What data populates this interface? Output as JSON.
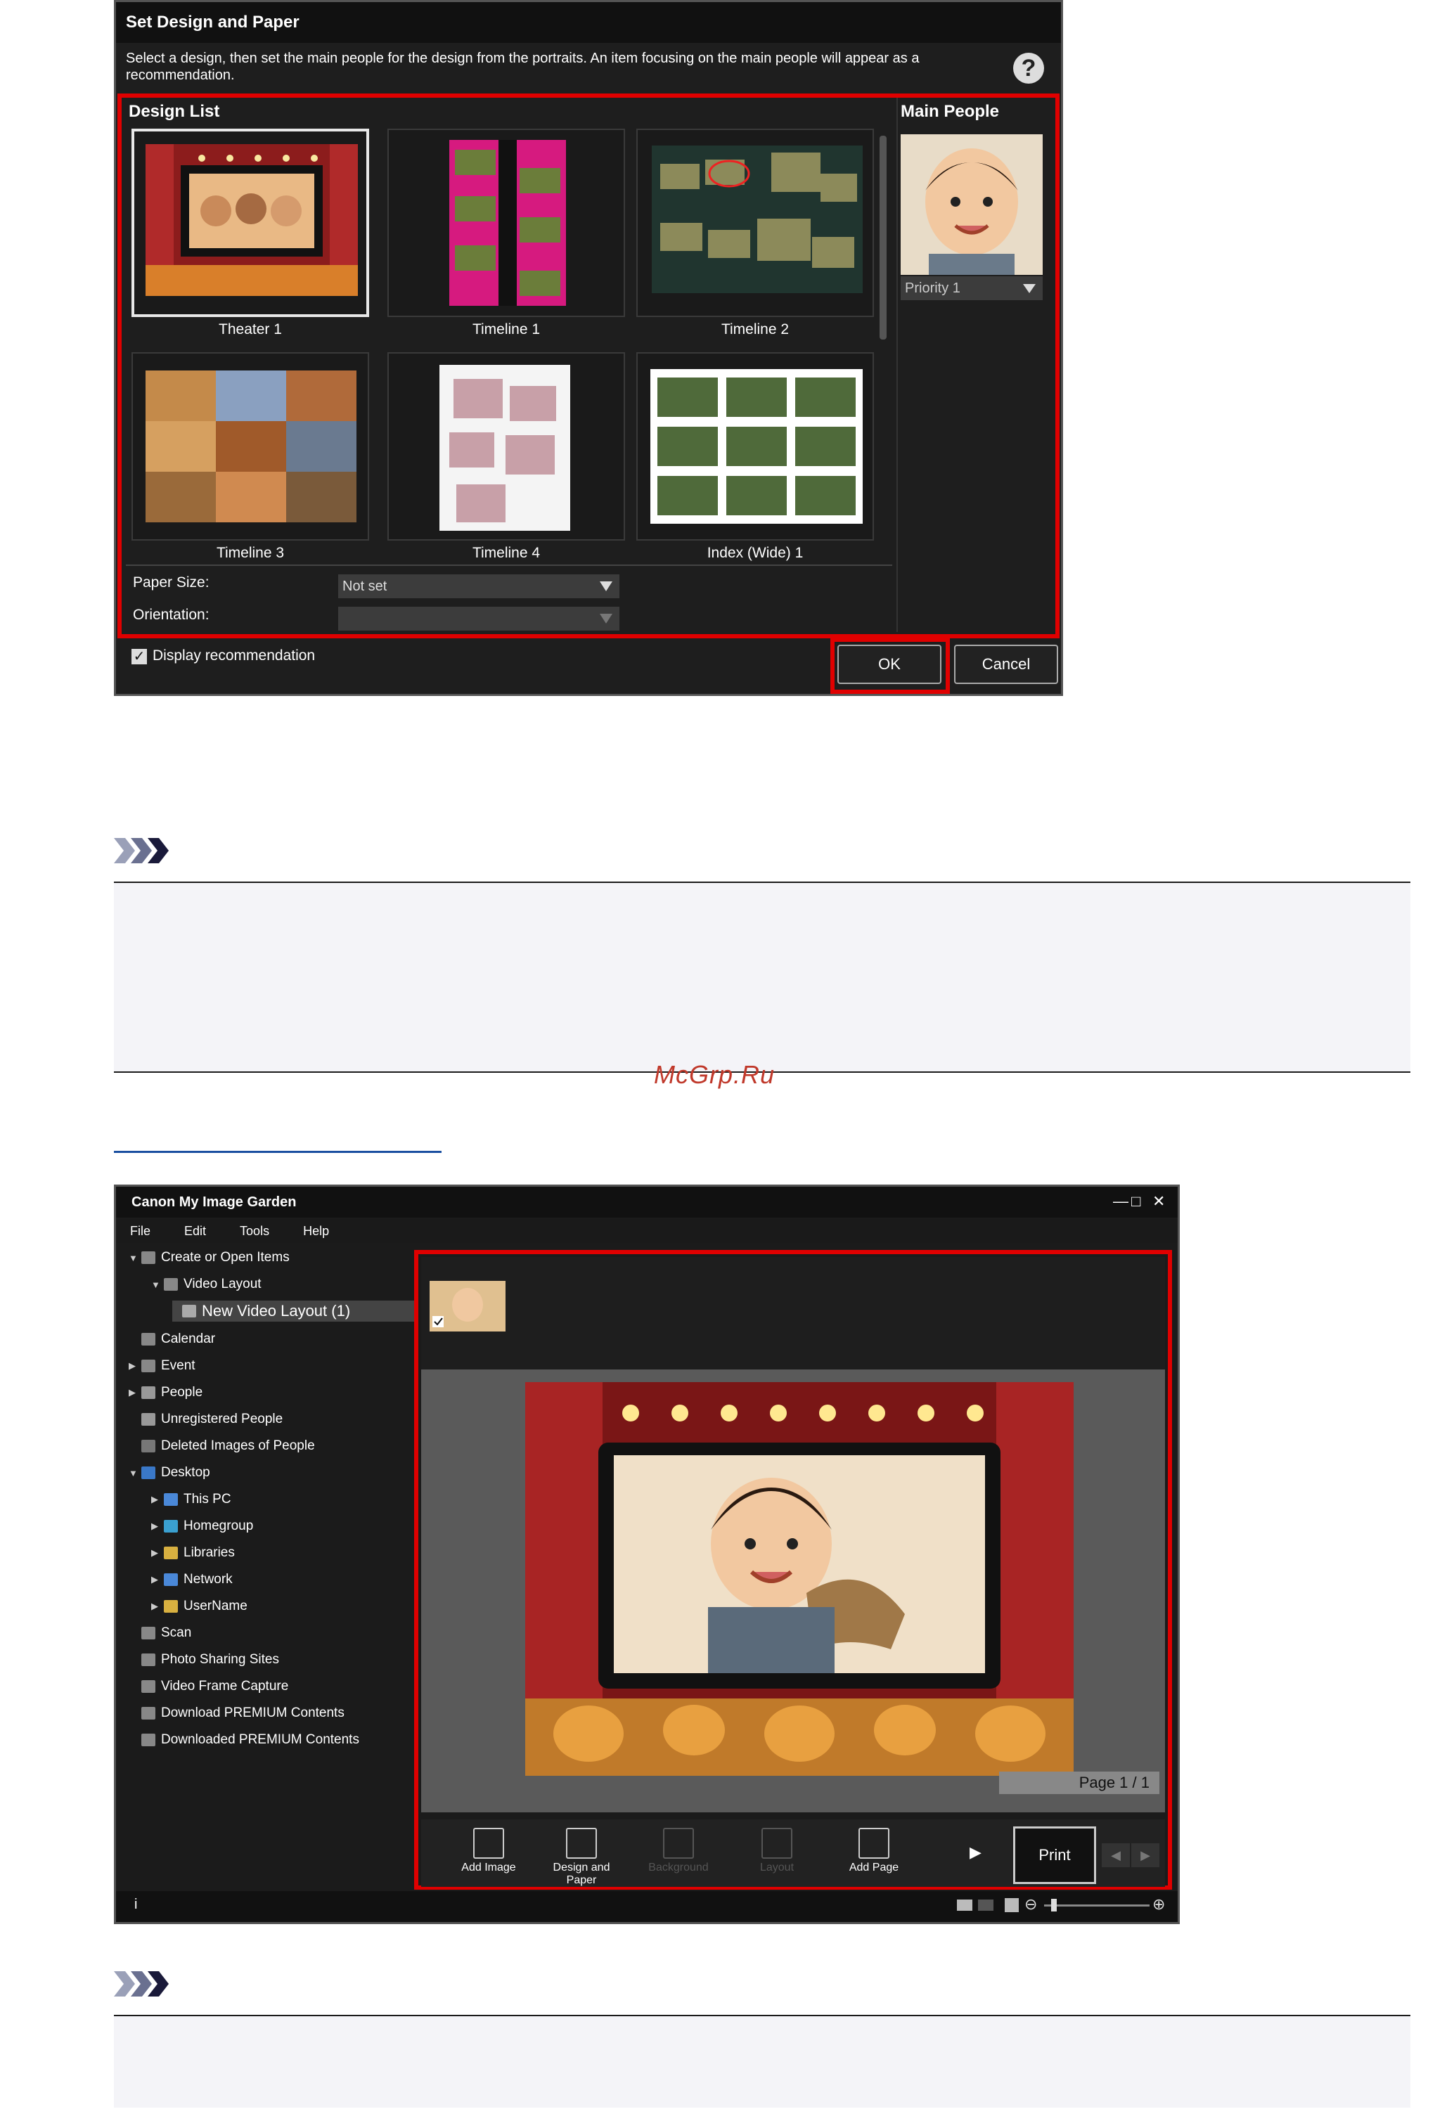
{
  "dialog": {
    "title": "Set Design and Paper",
    "instruction": "Select a design, then set the main people for the design from the portraits. An item focusing on the main people will appear as a recommendation.",
    "help_icon": "question-circle-icon",
    "design_list_label": "Design List",
    "main_people_label": "Main People",
    "designs": [
      {
        "label": "Theater 1"
      },
      {
        "label": "Timeline 1"
      },
      {
        "label": "Timeline 2"
      },
      {
        "label": "Timeline 3"
      },
      {
        "label": "Timeline 4"
      },
      {
        "label": "Index (Wide) 1"
      }
    ],
    "paper_size_label": "Paper Size:",
    "paper_size_value": "Not set",
    "orientation_label": "Orientation:",
    "orientation_value": "",
    "priority_value": "Priority 1",
    "display_recommendation_label": "Display recommendation",
    "ok_label": "OK",
    "cancel_label": "Cancel"
  },
  "watermark": "McGrp.Ru",
  "app": {
    "title": "Canon My Image Garden",
    "menu": [
      "File",
      "Edit",
      "Tools",
      "Help"
    ],
    "tree": [
      {
        "label": "Create or Open Items"
      },
      {
        "label": "Video Layout"
      },
      {
        "label": "New Video Layout (1)"
      },
      {
        "label": "Calendar"
      },
      {
        "label": "Event"
      },
      {
        "label": "People"
      },
      {
        "label": "Unregistered People"
      },
      {
        "label": "Deleted Images of People"
      },
      {
        "label": "Desktop"
      },
      {
        "label": "This PC"
      },
      {
        "label": "Homegroup"
      },
      {
        "label": "Libraries"
      },
      {
        "label": "Network"
      },
      {
        "label": "UserName"
      },
      {
        "label": "Scan"
      },
      {
        "label": "Photo Sharing Sites"
      },
      {
        "label": "Video Frame Capture"
      },
      {
        "label": "Download PREMIUM Contents"
      },
      {
        "label": "Downloaded PREMIUM Contents"
      }
    ],
    "page_indicator": "Page 1 / 1",
    "toolbar": {
      "add_image": "Add Image",
      "design_paper": "Design and Paper",
      "background": "Background",
      "layout": "Layout",
      "add_page": "Add Page",
      "print": "Print"
    },
    "status_info": "i"
  }
}
